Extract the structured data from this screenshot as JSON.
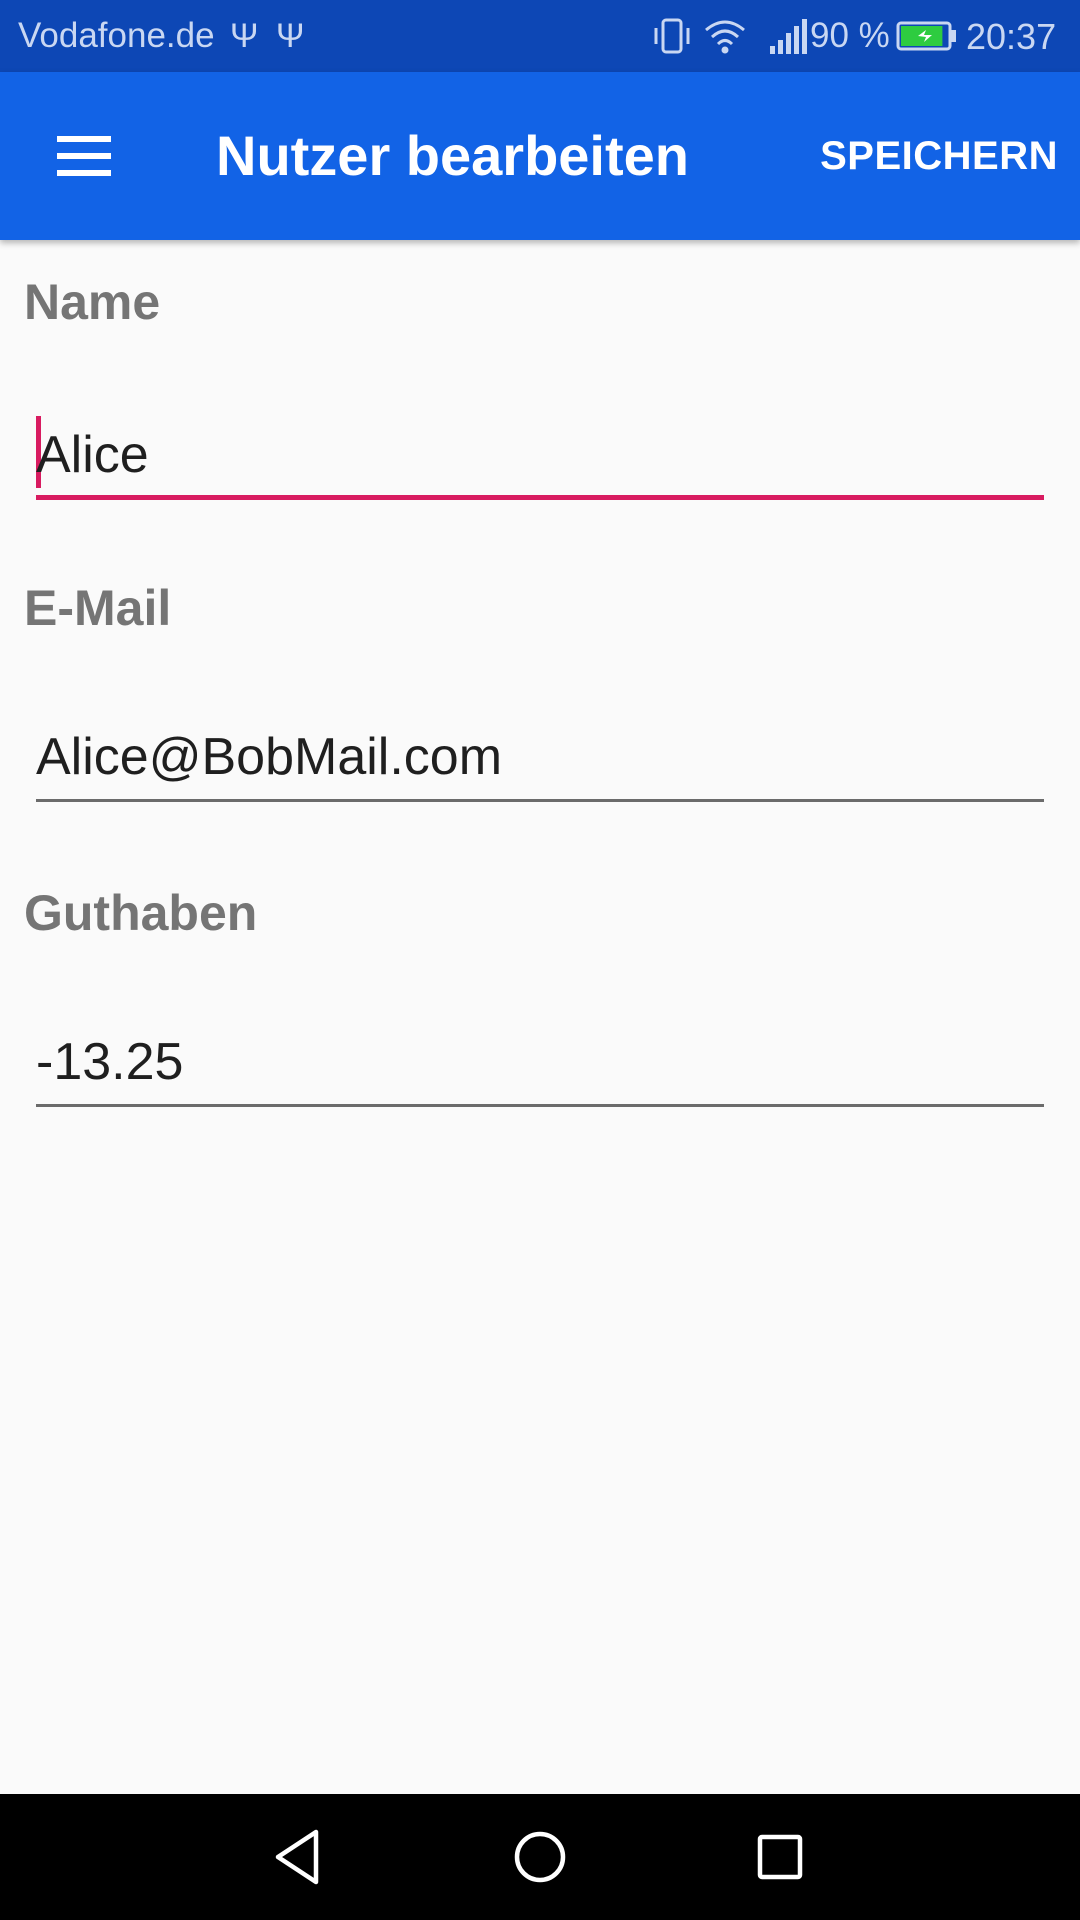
{
  "status_bar": {
    "carrier": "Vodafone.de",
    "usb_glyph": "Ψ",
    "battery_percent": "90 %",
    "time": "20:37",
    "icons": [
      "usb-icon",
      "usb-icon",
      "vibrate-icon",
      "wifi-icon",
      "signal-icon",
      "battery-charging-icon"
    ],
    "battery_level": 0.9,
    "battery_color": "#2ecc40"
  },
  "app_bar": {
    "title": "Nutzer bearbeiten",
    "save_label": "SPEICHERN",
    "menu_icon": "hamburger-menu-icon",
    "background_color": "#1263e6"
  },
  "form": {
    "name": {
      "label": "Name",
      "value": "Alice",
      "focused": true
    },
    "email": {
      "label": "E-Mail",
      "value": "Alice@BobMail.com"
    },
    "balance": {
      "label": "Guthaben",
      "value": "-13.25"
    },
    "accent_color": "#d81b60"
  },
  "nav_bar": {
    "buttons": [
      "back-icon",
      "home-icon",
      "recent-apps-icon"
    ]
  }
}
